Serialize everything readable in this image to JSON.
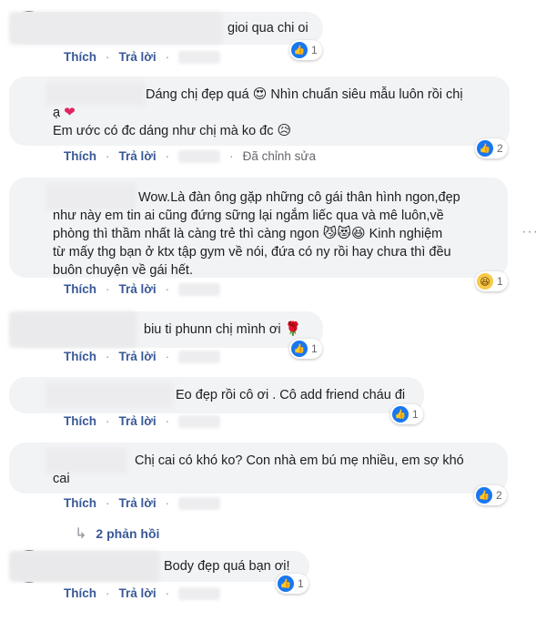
{
  "action_labels": {
    "like": "Thích",
    "reply": "Trả lời",
    "sep": "·",
    "edited": "Đã chỉnh sửa"
  },
  "comments": [
    {
      "text": "gioi qua chi oi",
      "reaction_count": "1"
    },
    {
      "text_line1": "Dáng chị đẹp quá",
      "text_line1b": "Nhìn chuẩn siêu mẫu luôn rồi chị",
      "text_line2": "ạ",
      "text_line3": "Em ước có đc dáng như chị mà ko đc",
      "reaction_count": "2"
    },
    {
      "lines": [
        "Wow.Là đàn ông gặp những cô gái thân hình ngon,đẹp",
        "như này em tin ai cũng đứng sững lại ngắm liếc qua và mê luôn,về",
        "phòng thì thầm nhất là càng trẻ thì càng ngon",
        "Kinh nghiệm",
        "từ mấy thg bạn ở ktx tập gym về nói, đứa có ny rồi hay chưa thì đều",
        "buôn chuyện về gái hết."
      ],
      "reaction_count": "1"
    },
    {
      "text": "biu ti phunn chị mình ơi",
      "reaction_count": "1"
    },
    {
      "text": "Eo đẹp rồi cô ơi . Cô add friend cháu đi",
      "reaction_count": "1"
    },
    {
      "line1": "Chị cai có khó ko? Con nhà em bú mẹ nhiều, em sợ khó",
      "line2": "cai",
      "reaction_count": "2"
    },
    {
      "text": "Body đẹp quá bạn ơi!",
      "reaction_count": "1"
    }
  ],
  "replies_link": "2 phản hồi",
  "icons": {
    "like": "like-icon",
    "haha": "haha-icon",
    "rose": "rose-icon",
    "more": "more-icon"
  },
  "colors": {
    "link": "#385898",
    "like_blue": "#1877f2",
    "bubble": "#f2f3f5"
  }
}
